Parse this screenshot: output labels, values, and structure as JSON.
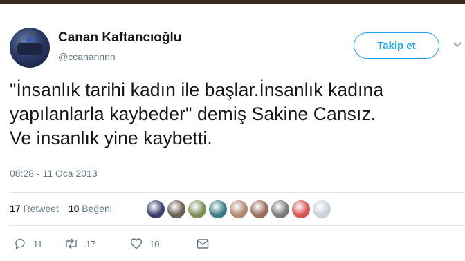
{
  "tweet": {
    "author_name": "Canan Kaftancıoğlu",
    "author_handle": "@ccanannnn",
    "follow_label": "Takip et",
    "text_line1": "\"İnsanlık tarihi kadın ile başlar.İnsanlık kadına",
    "text_line2": "yapılanlarla kaybeder\" demiş Sakine Cansız.",
    "text_line3": "Ve insanlık yine kaybetti.",
    "timestamp": "08:28 - 11 Oca 2013"
  },
  "stats": {
    "retweets_count": "17",
    "retweets_label": "Retweet",
    "likes_count": "10",
    "likes_label": "Beğeni"
  },
  "likers": [
    {
      "icon": "avatar-1",
      "color": "#3b3f6e"
    },
    {
      "icon": "avatar-2",
      "color": "#6b5e52"
    },
    {
      "icon": "avatar-3",
      "color": "#7d8f5a"
    },
    {
      "icon": "avatar-4",
      "color": "#3d7a86"
    },
    {
      "icon": "avatar-5",
      "color": "#b08870"
    },
    {
      "icon": "avatar-6",
      "color": "#9a6a5c"
    },
    {
      "icon": "avatar-7",
      "color": "#7b7b7b"
    },
    {
      "icon": "avatar-8",
      "color": "#d9534f"
    },
    {
      "icon": "avatar-9",
      "color": "#c9d1d8"
    }
  ],
  "actions": {
    "reply_count": "11",
    "retweet_count": "17",
    "like_count": "10"
  },
  "colors": {
    "accent": "#1da1f2",
    "muted": "#657786",
    "text": "#14171a"
  }
}
